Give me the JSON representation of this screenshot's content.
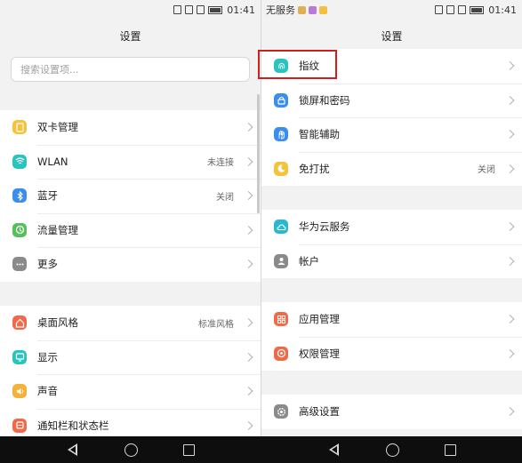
{
  "status": {
    "time": "01:41",
    "carrier": "无服务",
    "app_icon_colors": [
      "#e0b050",
      "#b87cd8",
      "#f0c040"
    ],
    "nfc": "NFC"
  },
  "left": {
    "title": "设置",
    "search": {
      "placeholder": "搜索设置项..."
    },
    "groups": [
      {
        "items": [
          {
            "label": "双卡管理",
            "value": "",
            "icon": "dual-sim-icon",
            "color": "#f5c23b"
          },
          {
            "label": "WLAN",
            "value": "未连接",
            "icon": "wifi-icon",
            "color": "#29c4c0"
          },
          {
            "label": "蓝牙",
            "value": "关闭",
            "icon": "bluetooth-icon",
            "color": "#3b8ef0"
          },
          {
            "label": "流量管理",
            "value": "",
            "icon": "data-usage-icon",
            "color": "#56c05a"
          },
          {
            "label": "更多",
            "value": "",
            "icon": "more-icon",
            "color": "#8a8a8a"
          }
        ]
      },
      {
        "items": [
          {
            "label": "桌面风格",
            "value": "标准风格",
            "icon": "home-style-icon",
            "color": "#f06a4a"
          },
          {
            "label": "显示",
            "value": "",
            "icon": "display-icon",
            "color": "#29c4c0"
          },
          {
            "label": "声音",
            "value": "",
            "icon": "sound-icon",
            "color": "#f5b23b"
          },
          {
            "label": "通知栏和状态栏",
            "value": "",
            "icon": "notification-icon",
            "color": "#f06a4a"
          }
        ]
      }
    ]
  },
  "right": {
    "title": "设置",
    "groups": [
      {
        "items": [
          {
            "label": "指纹",
            "value": "",
            "icon": "fingerprint-icon",
            "color": "#29c4c0"
          },
          {
            "label": "锁屏和密码",
            "value": "",
            "icon": "lock-icon",
            "color": "#3b8ef0"
          },
          {
            "label": "智能辅助",
            "value": "",
            "icon": "hand-icon",
            "color": "#3b8ef0"
          },
          {
            "label": "免打扰",
            "value": "关闭",
            "icon": "moon-icon",
            "color": "#f5c23b"
          }
        ]
      },
      {
        "items": [
          {
            "label": "华为云服务",
            "value": "",
            "icon": "cloud-icon",
            "color": "#29b8d0"
          },
          {
            "label": "帐户",
            "value": "",
            "icon": "account-icon",
            "color": "#8a8a8a"
          }
        ]
      },
      {
        "items": [
          {
            "label": "应用管理",
            "value": "",
            "icon": "apps-icon",
            "color": "#f06a4a"
          },
          {
            "label": "权限管理",
            "value": "",
            "icon": "permission-icon",
            "color": "#f06a4a"
          }
        ]
      },
      {
        "items": [
          {
            "label": "高级设置",
            "value": "",
            "icon": "advanced-settings-icon",
            "color": "#8a8a8a"
          }
        ]
      }
    ]
  },
  "navbar": {
    "buttons": [
      "back-icon",
      "home-icon",
      "recent-apps-icon"
    ]
  }
}
